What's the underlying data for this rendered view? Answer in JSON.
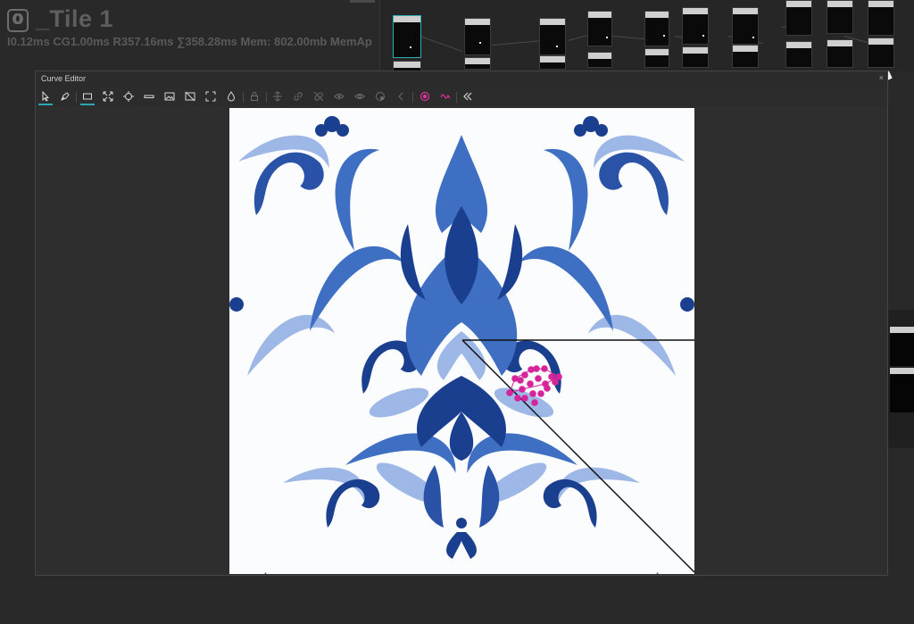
{
  "app": {
    "graph_title": "_Tile 1",
    "perf_stats": "I0.12ms CG1.00ms R357.16ms ∑358.28ms Mem: 802.00mb MemAp"
  },
  "panel": {
    "title": "Curve Editor",
    "close_symbol": "×"
  },
  "toolbar": {
    "tools": [
      {
        "name": "select-tool",
        "icon": "arrow-cursor-icon",
        "active": true
      },
      {
        "name": "pen-tool",
        "icon": "pen-nib-icon",
        "active": false
      },
      {
        "name": "rectangle-tool",
        "icon": "rectangle-icon",
        "active": true
      },
      {
        "name": "fit-tool",
        "icon": "expand-arrows-icon",
        "active": false
      },
      {
        "name": "target-tool",
        "icon": "crosshair-icon",
        "active": false
      },
      {
        "name": "bar-tool",
        "icon": "bar-icon",
        "active": false
      },
      {
        "name": "image-tool",
        "icon": "image-icon",
        "active": false
      },
      {
        "name": "no-image-tool",
        "icon": "image-slash-icon",
        "active": false
      },
      {
        "name": "frame-tool",
        "icon": "frame-corners-icon",
        "active": false
      },
      {
        "name": "drop-tool",
        "icon": "drop-icon",
        "active": false
      },
      {
        "name": "lock-tool",
        "icon": "lock-icon",
        "active": false
      },
      {
        "name": "split-tool",
        "icon": "split-vertical-icon",
        "active": false
      },
      {
        "name": "link-tool",
        "icon": "link-icon",
        "active": false
      },
      {
        "name": "unlink-tool",
        "icon": "unlink-icon",
        "active": false
      },
      {
        "name": "visible-tool",
        "icon": "eye-icon",
        "active": false
      },
      {
        "name": "visible-all-tool",
        "icon": "eye-outline-icon",
        "active": false
      },
      {
        "name": "palette-tool",
        "icon": "palette-icon",
        "active": false
      },
      {
        "name": "previous-tool",
        "icon": "chevron-left-icon",
        "active": false
      },
      {
        "name": "record-tool",
        "icon": "record-icon",
        "active": false,
        "color": "#e0339f"
      },
      {
        "name": "curve-tool",
        "icon": "curve-wave-icon",
        "active": false,
        "color": "#e0339f"
      },
      {
        "name": "collapse-tool",
        "icon": "double-chevron-left-icon",
        "active": false
      }
    ]
  },
  "colors": {
    "accent": "#2aa8b4",
    "curve_point": "#d6249a",
    "pattern_dark": "#1b3f8f",
    "pattern_mid": "#3f6fc2",
    "pattern_light": "#9db7e6"
  }
}
